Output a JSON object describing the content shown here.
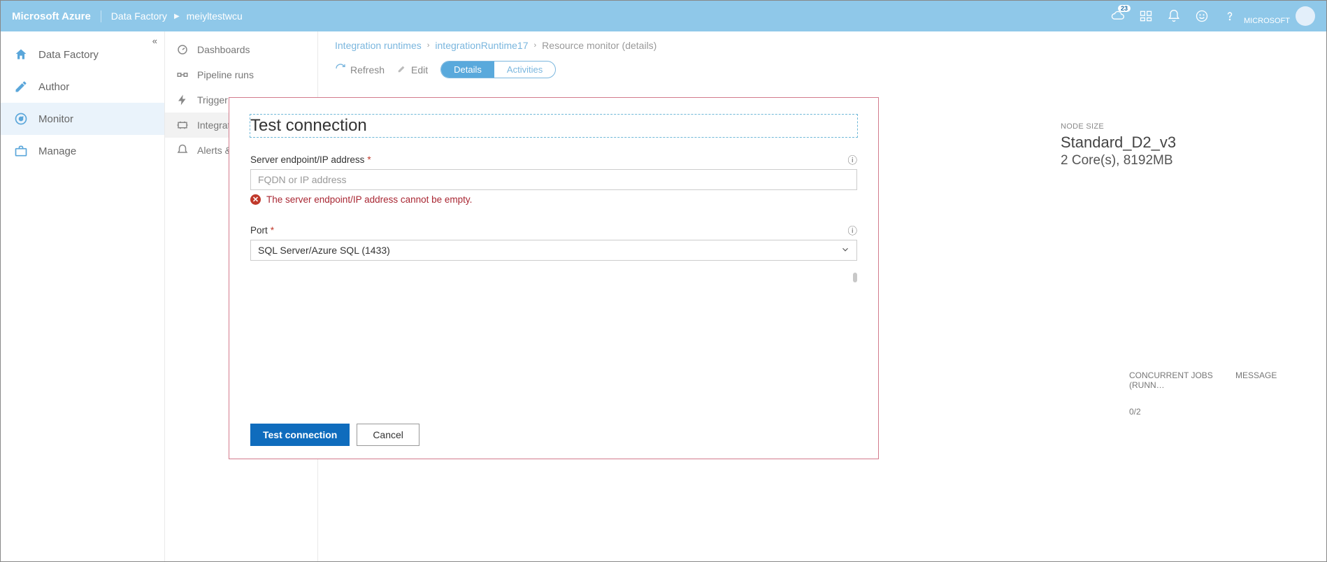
{
  "topbar": {
    "brand": "Microsoft Azure",
    "crumb1": "Data Factory",
    "crumb2": "meiyltestwcu",
    "notif_count": "23",
    "tenant": "MICROSOFT"
  },
  "rail": {
    "items": [
      {
        "label": "Data Factory"
      },
      {
        "label": "Author"
      },
      {
        "label": "Monitor"
      },
      {
        "label": "Manage"
      }
    ],
    "collapse_glyph": "«"
  },
  "col2": {
    "items": [
      {
        "label": "Dashboards"
      },
      {
        "label": "Pipeline runs"
      },
      {
        "label": "Trigger runs"
      },
      {
        "label": "Integrati"
      },
      {
        "label": "Alerts &"
      }
    ]
  },
  "breadcrumbs": {
    "a": "Integration runtimes",
    "b": "integrationRuntime17",
    "c": "Resource monitor (details)"
  },
  "toolbar": {
    "refresh": "Refresh",
    "edit": "Edit",
    "details": "Details",
    "activities": "Activities"
  },
  "bgcard": {
    "label": "NODE SIZE",
    "v1": "Standard_D2_v3",
    "v2": "2 Core(s), 8192MB"
  },
  "bgtable": {
    "h1": "CONCURRENT JOBS (RUNN…",
    "h2": "MESSAGE",
    "d1": "0/2"
  },
  "dialog": {
    "title": "Test connection",
    "server_label": "Server endpoint/IP address",
    "server_placeholder": "FQDN or IP address",
    "server_error": "The server endpoint/IP address cannot be empty.",
    "port_label": "Port",
    "port_value": "SQL Server/Azure SQL (1433)",
    "btn_test": "Test connection",
    "btn_cancel": "Cancel",
    "info_glyph": "ⓘ",
    "req_glyph": "*"
  }
}
